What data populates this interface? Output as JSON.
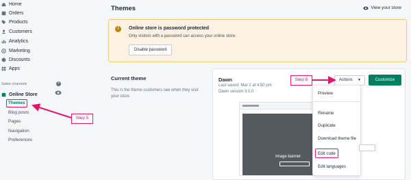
{
  "sidebar": {
    "items": [
      {
        "label": "Home",
        "icon": "home-icon"
      },
      {
        "label": "Orders",
        "icon": "orders-icon"
      },
      {
        "label": "Products",
        "icon": "tag-icon"
      },
      {
        "label": "Customers",
        "icon": "person-icon"
      },
      {
        "label": "Analytics",
        "icon": "bar-chart-icon"
      },
      {
        "label": "Marketing",
        "icon": "target-icon"
      },
      {
        "label": "Discounts",
        "icon": "discount-icon"
      },
      {
        "label": "Apps",
        "icon": "apps-icon"
      }
    ],
    "sales_channels_label": "Sales channels",
    "online_store_label": "Online Store",
    "sub_items": [
      "Themes",
      "Blog posts",
      "Pages",
      "Navigation",
      "Preferences"
    ]
  },
  "header": {
    "title": "Themes",
    "view_store": "View your store"
  },
  "banner": {
    "title": "Online store is password protected",
    "text": "Only visitors with a password can access your online store.",
    "button": "Disable password"
  },
  "current_theme": {
    "title": "Current theme",
    "description": "This is the theme customers see when they visit your store."
  },
  "theme_card": {
    "name": "Dawn",
    "last_saved": "Last saved: Mar 2 at 4:50 pm",
    "version": "Dawn version 3.0.0",
    "actions_label": "Actions",
    "customize_label": "Customize",
    "preview_caption": "Image banner"
  },
  "actions_menu": [
    "Preview",
    "Rename",
    "Duplicate",
    "Download theme file",
    "Edit code",
    "Edit languages"
  ],
  "steps": {
    "step5": "Step 5",
    "step6": "Step 6"
  },
  "colors": {
    "accent": "#008060",
    "annotation": "#e8146c",
    "banner_bg": "#fcf1e3"
  }
}
